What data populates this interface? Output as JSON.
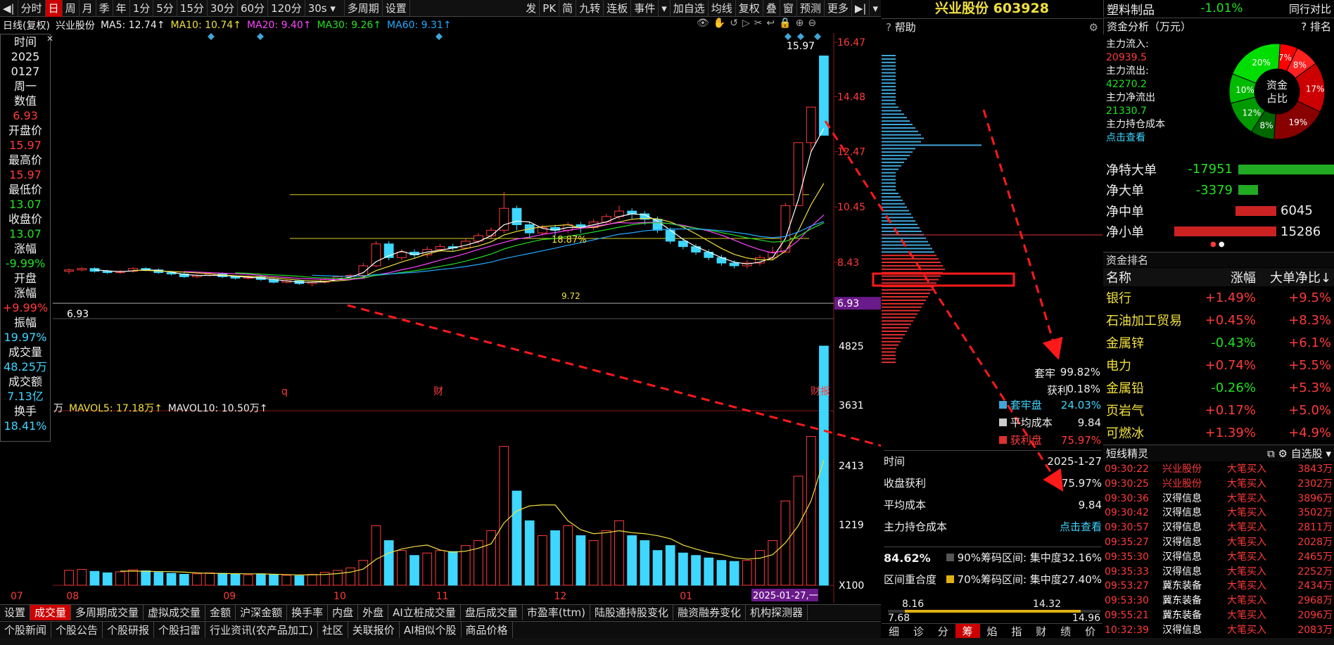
{
  "toolbar": {
    "items": [
      "分时",
      "日",
      "周",
      "月",
      "季",
      "年",
      "1分",
      "5分",
      "15分",
      "30分",
      "60分",
      "120分",
      "30s",
      "多周期",
      "设置"
    ],
    "right_items": [
      "发",
      "PK",
      "简",
      "九转",
      "连板",
      "事件",
      "加自选",
      "均线",
      "复权",
      "叠",
      "窗",
      "预测",
      "更多"
    ]
  },
  "chart_header": {
    "mode": "日线(复权)",
    "stock": "兴业股份",
    "ma5": "MA5: 12.74↑",
    "ma10": "MA10: 10.74↑",
    "ma20": "MA20: 9.40↑",
    "ma30": "MA30: 9.26↑",
    "ma60": "MA60: 9.31↑"
  },
  "colors": {
    "up": "#ff3b3b",
    "down": "#3fd7ff",
    "ma5": "#ffffff",
    "ma10": "#f0e040",
    "ma20": "#ff44ff",
    "ma30": "#22dd22",
    "ma60": "#22aaff"
  },
  "side": {
    "time_label": "时间",
    "year": "2025",
    "date": "0127",
    "weekday": "周一",
    "value_label": "数值",
    "value": "6.93",
    "open_label": "开盘价",
    "open": "15.97",
    "high_label": "最高价",
    "high": "15.97",
    "low_label": "最低价",
    "low": "13.07",
    "close_label": "收盘价",
    "close": "13.07",
    "chg_label": "涨幅",
    "chg": "-9.99%",
    "open_chg_label": "开盘",
    "open_chg_label2": "涨幅",
    "open_chg": "+9.99%",
    "amp_label": "振幅",
    "amp": "19.97%",
    "vol_label": "成交量",
    "vol": "48.25万",
    "amt_label": "成交额",
    "amt": "7.13亿",
    "turn_label": "换手",
    "turn": "18.41%"
  },
  "price_axis": [
    "16.47",
    "14.48",
    "12.47",
    "10.45",
    "8.43",
    "6.93"
  ],
  "vol_axis": [
    "4825",
    "3631",
    "2413",
    "1219",
    "X100"
  ],
  "annotations": {
    "top_price": "15.97",
    "low_price": "6.93",
    "pct": "18.87%",
    "mid_price": "9.72",
    "markers": [
      "q",
      "财",
      "财报"
    ],
    "current_date": "2025-01-27,一"
  },
  "x_labels": [
    "07",
    "08",
    "09",
    "10",
    "11",
    "12",
    "01"
  ],
  "vol_header": {
    "unit": "万",
    "mavol5": "MAVOL5: 17.18万↑",
    "mavol10": "MAVOL10: 10.50万↑"
  },
  "chip": {
    "help": "帮助",
    "stock_title": "兴业股份 603928",
    "tao": "套牢",
    "tao_val": "99.82%",
    "profit": "获利",
    "profit_val": "0.18%",
    "legend_tao": "套牢盘",
    "legend_tao_val": "24.03%",
    "legend_avg": "平均成本",
    "legend_avg_val": "9.84",
    "legend_prof": "获利盘",
    "legend_prof_val": "75.97%",
    "time_label": "时间",
    "time_val": "2025-1-27",
    "close_profit_label": "收盘获利",
    "close_profit_val": "75.97%",
    "avg_cost_label": "平均成本",
    "avg_cost_val": "9.84",
    "main_cost_label": "主力持仓成本",
    "main_cost_link": "点击查看",
    "conc": "84.62%",
    "r90": "90%筹码区间: 集中度32.16%",
    "overlap": "区间重合度",
    "r70": "70%筹码区间: 集中度27.40%",
    "b1": "8.16",
    "b2": "14.32",
    "b3": "7.68",
    "b4": "14.96",
    "tabs": [
      "细",
      "诊",
      "分",
      "筹",
      "焰",
      "指",
      "财",
      "绩",
      "价"
    ]
  },
  "sector": {
    "name": "塑料制品",
    "chg": "-1.01%",
    "compare": "同行对比"
  },
  "fund": {
    "title": "资金分析（万元）",
    "rank_label": "排名",
    "inflow_label": "主力流入:",
    "inflow": "20939.5",
    "outflow_label": "主力流出:",
    "outflow": "42270.2",
    "net_label": "主力净流出",
    "net": "21330.7",
    "cost_label": "主力持仓成本",
    "cost_link": "点击查看",
    "donut_label1": "资金",
    "donut_label2": "占比",
    "slices": [
      {
        "v": "7%",
        "c": "#ff0000"
      },
      {
        "v": "8%",
        "c": "#ff2020"
      },
      {
        "v": "17%",
        "c": "#cc0000"
      },
      {
        "v": "19%",
        "c": "#880000"
      },
      {
        "v": "8%",
        "c": "#006600"
      },
      {
        "v": "12%",
        "c": "#009900"
      },
      {
        "v": "10%",
        "c": "#00bb00"
      },
      {
        "v": "20%",
        "c": "#00dd00"
      }
    ]
  },
  "orders": [
    {
      "label": "净特大单",
      "value": "-17951",
      "frac": 1.0,
      "c": "#22aa22"
    },
    {
      "label": "净大单",
      "value": "-3379",
      "frac": 0.19,
      "c": "#22aa22"
    },
    {
      "label": "净中单",
      "value": "6045",
      "frac": 0.4,
      "c": "#cc2222"
    },
    {
      "label": "净小单",
      "value": "15286",
      "frac": 1.0,
      "c": "#cc2222"
    }
  ],
  "rank": {
    "title": "资金排名",
    "cols": [
      "名称",
      "涨幅",
      "大单净比↓"
    ],
    "rows": [
      [
        "银行",
        "+1.49%",
        "+9.5%"
      ],
      [
        "石油加工贸易",
        "+0.45%",
        "+8.3%"
      ],
      [
        "金属锌",
        "-0.43%",
        "+6.1%"
      ],
      [
        "电力",
        "+0.74%",
        "+5.5%"
      ],
      [
        "金属铅",
        "-0.26%",
        "+5.3%"
      ],
      [
        "页岩气",
        "+0.17%",
        "+5.0%"
      ],
      [
        "可燃冰",
        "+1.39%",
        "+4.9%"
      ]
    ]
  },
  "trades": {
    "title": "短线精灵",
    "tab": "自选股",
    "rows": [
      [
        "09:30:22",
        "兴业股份",
        "大笔买入",
        "3843万"
      ],
      [
        "09:30:25",
        "兴业股份",
        "大笔买入",
        "2302万"
      ],
      [
        "09:30:36",
        "汉得信息",
        "大笔买入",
        "3896万"
      ],
      [
        "09:30:42",
        "汉得信息",
        "大笔买入",
        "3502万"
      ],
      [
        "09:30:57",
        "汉得信息",
        "大笔买入",
        "2811万"
      ],
      [
        "09:35:27",
        "汉得信息",
        "大笔买入",
        "2028万"
      ],
      [
        "09:35:30",
        "汉得信息",
        "大笔买入",
        "2465万"
      ],
      [
        "09:35:33",
        "汉得信息",
        "大笔买入",
        "2252万"
      ],
      [
        "09:53:27",
        "冀东装备",
        "大笔买入",
        "2434万"
      ],
      [
        "09:53:30",
        "冀东装备",
        "大笔买入",
        "2968万"
      ],
      [
        "09:55:21",
        "冀东装备",
        "大笔买入",
        "2096万"
      ],
      [
        "10:32:39",
        "汉得信息",
        "大笔买入",
        "2083万"
      ]
    ]
  },
  "bottom_tabs": [
    "设置",
    "成交量",
    "多周期成交量",
    "虚拟成交量",
    "金额",
    "沪深金额",
    "换手率",
    "内盘",
    "外盘",
    "AI立桩成交量",
    "盘后成交量",
    "市盈率(ttm)",
    "陆股通持股变化",
    "融资融券变化",
    "机构探测器"
  ],
  "bottom_tabs2": [
    "个股新闻",
    "个股公告",
    "个股研报",
    "个股扫雷",
    "行业资讯(农产品加工)",
    "社区",
    "关联报价",
    "AI相似个股",
    "商品价格"
  ],
  "candles": [
    [
      8.1,
      8.15,
      8.0,
      8.2
    ],
    [
      8.15,
      8.2,
      8.1,
      8.25
    ],
    [
      8.2,
      8.1,
      8.05,
      8.25
    ],
    [
      8.1,
      8.05,
      8.0,
      8.15
    ],
    [
      8.05,
      8.1,
      8.0,
      8.15
    ],
    [
      8.1,
      8.2,
      8.05,
      8.25
    ],
    [
      8.2,
      8.15,
      8.1,
      8.25
    ],
    [
      8.15,
      8.05,
      8.0,
      8.2
    ],
    [
      8.05,
      8.0,
      7.95,
      8.1
    ],
    [
      8.0,
      7.9,
      7.85,
      8.05
    ],
    [
      7.9,
      7.95,
      7.85,
      8.0
    ],
    [
      7.95,
      8.0,
      7.9,
      8.05
    ],
    [
      8.0,
      7.9,
      7.85,
      8.05
    ],
    [
      7.9,
      7.85,
      7.8,
      7.95
    ],
    [
      7.85,
      7.9,
      7.8,
      7.95
    ],
    [
      7.9,
      7.8,
      7.75,
      7.95
    ],
    [
      7.8,
      7.7,
      7.65,
      7.85
    ],
    [
      7.7,
      7.75,
      7.65,
      7.8
    ],
    [
      7.75,
      7.65,
      7.6,
      7.8
    ],
    [
      7.65,
      7.7,
      7.55,
      7.75
    ],
    [
      7.7,
      7.8,
      7.65,
      7.85
    ],
    [
      7.8,
      7.9,
      7.75,
      7.95
    ],
    [
      7.9,
      7.95,
      7.85,
      8.0
    ],
    [
      7.95,
      8.3,
      7.9,
      8.4
    ],
    [
      8.3,
      9.1,
      8.25,
      9.2
    ],
    [
      9.1,
      8.6,
      8.5,
      9.2
    ],
    [
      8.6,
      8.8,
      8.5,
      8.9
    ],
    [
      8.8,
      8.7,
      8.6,
      8.9
    ],
    [
      8.7,
      8.9,
      8.6,
      9.0
    ],
    [
      8.9,
      9.0,
      8.8,
      9.1
    ],
    [
      9.0,
      8.95,
      8.85,
      9.1
    ],
    [
      8.95,
      9.2,
      8.9,
      9.3
    ],
    [
      9.2,
      9.4,
      9.1,
      9.5
    ],
    [
      9.4,
      9.6,
      9.3,
      9.7
    ],
    [
      9.6,
      10.4,
      9.5,
      11.0
    ],
    [
      10.4,
      9.8,
      9.6,
      10.5
    ],
    [
      9.8,
      9.5,
      9.3,
      9.9
    ],
    [
      9.5,
      9.7,
      9.4,
      9.8
    ],
    [
      9.7,
      9.6,
      9.4,
      9.8
    ],
    [
      9.6,
      9.8,
      9.5,
      9.9
    ],
    [
      9.8,
      9.7,
      9.5,
      9.9
    ],
    [
      9.7,
      9.9,
      9.6,
      10.0
    ],
    [
      9.9,
      10.1,
      9.8,
      10.2
    ],
    [
      10.1,
      10.3,
      10.0,
      10.5
    ],
    [
      10.3,
      10.2,
      10.0,
      10.4
    ],
    [
      10.2,
      10.0,
      9.8,
      10.3
    ],
    [
      10.0,
      9.6,
      9.5,
      10.1
    ],
    [
      9.6,
      9.2,
      9.1,
      9.7
    ],
    [
      9.2,
      9.0,
      8.9,
      9.3
    ],
    [
      9.0,
      8.8,
      8.7,
      9.1
    ],
    [
      8.8,
      8.6,
      8.5,
      8.9
    ],
    [
      8.6,
      8.4,
      8.3,
      8.7
    ],
    [
      8.4,
      8.3,
      8.2,
      8.5
    ],
    [
      8.3,
      8.4,
      8.2,
      8.5
    ],
    [
      8.4,
      8.6,
      8.3,
      8.7
    ],
    [
      8.6,
      8.8,
      8.5,
      9.0
    ],
    [
      8.8,
      10.5,
      8.8,
      10.6
    ],
    [
      10.5,
      12.8,
      10.5,
      12.8
    ],
    [
      12.8,
      14.1,
      12.5,
      14.1
    ],
    [
      15.97,
      13.07,
      13.07,
      15.97
    ]
  ],
  "volumes": [
    300,
    320,
    280,
    250,
    270,
    310,
    290,
    260,
    240,
    220,
    230,
    250,
    240,
    220,
    210,
    230,
    210,
    200,
    190,
    220,
    260,
    300,
    350,
    500,
    1200,
    900,
    700,
    600,
    650,
    700,
    680,
    800,
    900,
    1100,
    2800,
    1900,
    1300,
    1000,
    1100,
    1200,
    1000,
    900,
    1100,
    1300,
    1000,
    900,
    700,
    800,
    650,
    600,
    550,
    500,
    480,
    500,
    700,
    900,
    1700,
    2200,
    3000,
    4825
  ]
}
